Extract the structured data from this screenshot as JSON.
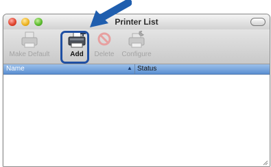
{
  "window": {
    "title": "Printer List"
  },
  "toolbar": {
    "make_default": "Make Default",
    "add": "Add",
    "delete": "Delete",
    "configure": "Configure"
  },
  "list": {
    "columns": [
      "Name",
      "Status"
    ],
    "sort_indicator": "▲",
    "rows": []
  },
  "colors": {
    "header_blue": "#5b8fd2",
    "highlight_blue": "#1f4fa3",
    "arrow_blue": "#1f5eae"
  },
  "icons": {
    "make_default": "printer-icon",
    "add": "add-printer-icon",
    "delete": "delete-icon",
    "configure": "configure-printer-icon"
  }
}
